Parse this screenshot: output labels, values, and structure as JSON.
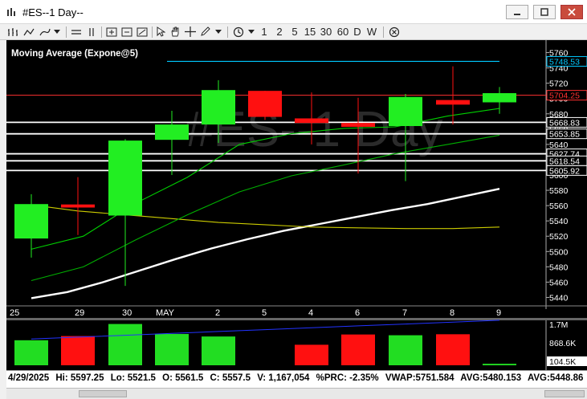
{
  "window": {
    "title": "#ES--1 Day--"
  },
  "toolbar": {
    "periods": [
      "1",
      "2",
      "5",
      "15",
      "30",
      "60",
      "D",
      "W"
    ]
  },
  "chart": {
    "indicator_label": "Moving Average (Expone@5)",
    "watermark": "#ES--1 Day",
    "y_ticks": [
      "5760",
      "5740",
      "5720",
      "5700",
      "5680",
      "5660",
      "5640",
      "5620",
      "5600",
      "5580",
      "5560",
      "5540",
      "5520",
      "5500",
      "5480",
      "5460",
      "5440"
    ],
    "x_labels": [
      "25",
      "29",
      "30",
      "MAY",
      "2",
      "5",
      "4",
      "6",
      "7",
      "8",
      "9"
    ],
    "price_tags": [
      {
        "label": "5748.53",
        "value": 5748.53,
        "color": "#00c8ff"
      },
      {
        "label": "5704.25",
        "value": 5704.25,
        "color": "#ff3030"
      },
      {
        "label": "5668.83",
        "value": 5668.83,
        "color": "#ffffff"
      },
      {
        "label": "5653.85",
        "value": 5653.85,
        "color": "#ffffff"
      },
      {
        "label": "5627.74",
        "value": 5627.74,
        "color": "#ffffff"
      },
      {
        "label": "5618.54",
        "value": 5618.54,
        "color": "#ffffff"
      },
      {
        "label": "5605.92",
        "value": 5605.92,
        "color": "#ffffff"
      }
    ],
    "volume_ticks": [
      "1.7M",
      "868.6K",
      "104.5K"
    ]
  },
  "chart_data": {
    "type": "candlestick",
    "price_ylim": [
      5430,
      5770
    ],
    "candles": [
      {
        "date": "25",
        "open": 5517,
        "high": 5575,
        "low": 5492,
        "close": 5562
      },
      {
        "date": "29",
        "open": 5561.5,
        "high": 5597.25,
        "low": 5521.5,
        "close": 5557.5
      },
      {
        "date": "30",
        "open": 5547,
        "high": 5647,
        "low": 5455,
        "close": 5645
      },
      {
        "date": "MAY",
        "open": 5646,
        "high": 5684,
        "low": 5600,
        "close": 5666
      },
      {
        "date": "2",
        "open": 5666,
        "high": 5724,
        "low": 5642,
        "close": 5711
      },
      {
        "date": "5",
        "open": 5710,
        "high": 5710,
        "low": 5672,
        "close": 5676
      },
      {
        "date": "4",
        "open": 5674,
        "high": 5708,
        "low": 5640,
        "close": 5668
      },
      {
        "date": "6",
        "open": 5668,
        "high": 5701,
        "low": 5602,
        "close": 5663
      },
      {
        "date": "7",
        "open": 5664,
        "high": 5706,
        "low": 5592,
        "close": 5702
      },
      {
        "date": "8",
        "open": 5698,
        "high": 5742,
        "low": 5666,
        "close": 5692
      },
      {
        "date": "9",
        "open": 5695,
        "high": 5715,
        "low": 5680,
        "close": 5707
      }
    ],
    "moving_averages": [
      {
        "color": "#ffffff",
        "values": [
          5439,
          5447,
          5460,
          5475,
          5490,
          5504,
          5516,
          5527,
          5536,
          5545,
          5554,
          5562,
          5572,
          5582
        ]
      },
      {
        "color": "#cccc00",
        "values": [
          5561,
          5553,
          5548,
          5543,
          5538,
          5535,
          5532,
          5531,
          5530,
          5530,
          5532
        ]
      },
      {
        "color": "#00b000",
        "values": [
          5462,
          5480,
          5515,
          5548,
          5578,
          5599,
          5613,
          5628,
          5640,
          5652
        ]
      },
      {
        "color": "#00d000",
        "values": [
          5503,
          5520,
          5563,
          5597,
          5640,
          5654,
          5661,
          5663,
          5677,
          5687
        ]
      }
    ],
    "volume_ylim": [
      0,
      1700000
    ],
    "volume": [
      {
        "date": "25",
        "value": 1000000,
        "color": "#22dd22"
      },
      {
        "date": "29",
        "value": 1167054,
        "color": "#ff1010"
      },
      {
        "date": "30",
        "value": 1650000,
        "color": "#22dd22"
      },
      {
        "date": "MAY",
        "value": 1250000,
        "color": "#22dd22"
      },
      {
        "date": "2",
        "value": 1150000,
        "color": "#22dd22"
      },
      {
        "date": "5",
        "value": 0,
        "color": "#ff1010"
      },
      {
        "date": "4",
        "value": 820000,
        "color": "#ff1010"
      },
      {
        "date": "6",
        "value": 1230000,
        "color": "#ff1010"
      },
      {
        "date": "7",
        "value": 1200000,
        "color": "#22dd22"
      },
      {
        "date": "8",
        "value": 1240000,
        "color": "#ff1010"
      },
      {
        "date": "9",
        "value": 60000,
        "color": "#22dd22"
      }
    ]
  },
  "status": {
    "date": "4/29/2025",
    "hi": "Hi: 5597.25",
    "lo": "Lo: 5521.5",
    "open": "O: 5561.5",
    "close": "C: 5557.5",
    "vol": "V: 1,167,054",
    "prc": "%PRC: -2.35%",
    "vwap": "VWAP:5751.584",
    "avg1": "AVG:5480.153",
    "avg2": "AVG:5448.86"
  }
}
